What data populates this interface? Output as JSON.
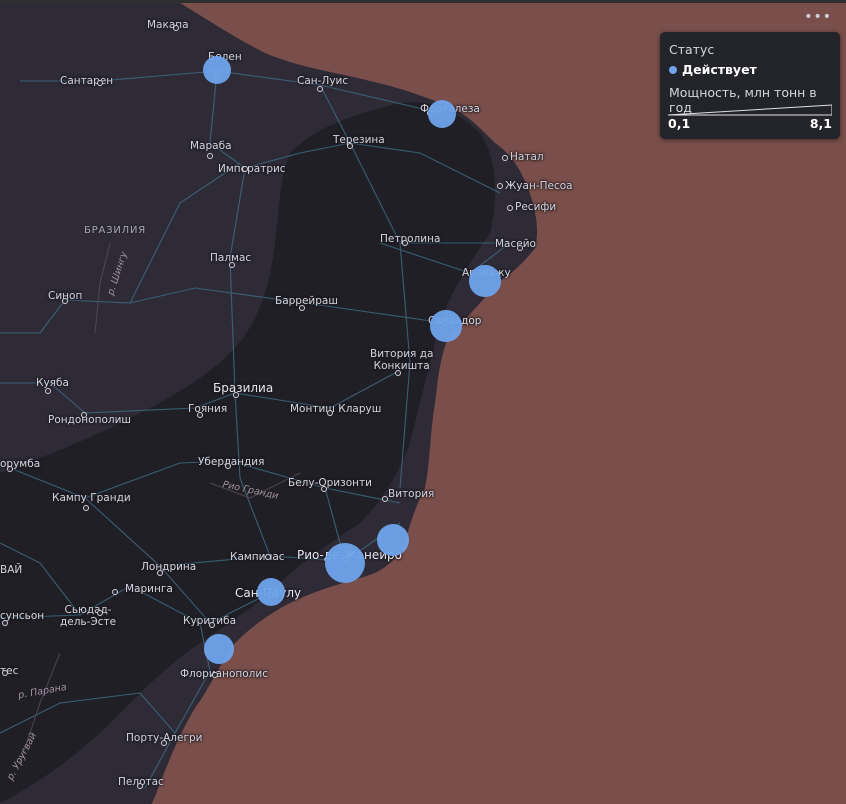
{
  "ui": {
    "menu_glyph": "•••",
    "menu_icon": "more-horizontal-icon"
  },
  "legend": {
    "title": "Статус",
    "status_label": "Действует",
    "status_color": "#6fa3ec",
    "capacity_title": "Мощность, млн тонн в год",
    "capacity_min": "0,1",
    "capacity_max": "8,1"
  },
  "colors": {
    "ocean": "#7a4e4a",
    "land": "#2e2b36",
    "land_dark": "#1d1c21",
    "roads": "#3b6a80",
    "marker": "#6fa3ec"
  },
  "map": {
    "country_label": "БРАЗИЛИЯ",
    "cities": [
      {
        "key": "makapa",
        "name": "Макапа"
      },
      {
        "key": "belen",
        "name": "Белен"
      },
      {
        "key": "santaren",
        "name": "Сантарен"
      },
      {
        "key": "sanluis",
        "name": "Сан-Луис"
      },
      {
        "key": "fortaleza",
        "name": "Форталеза"
      },
      {
        "key": "terezina",
        "name": "Терезина"
      },
      {
        "key": "maraba",
        "name": "Мараба"
      },
      {
        "key": "imperatris",
        "name": "Императрис"
      },
      {
        "key": "natal",
        "name": "Натал"
      },
      {
        "key": "zhuanpesoa",
        "name": "Жуан-Песоа"
      },
      {
        "key": "resifi",
        "name": "Ресифи"
      },
      {
        "key": "petrolina",
        "name": "Петролина"
      },
      {
        "key": "maseio",
        "name": "Масейо"
      },
      {
        "key": "palmas",
        "name": "Палмас"
      },
      {
        "key": "arakazhu",
        "name": "Аракажу"
      },
      {
        "key": "sinop",
        "name": "Синоп"
      },
      {
        "key": "barreiras",
        "name": "Баррейраш"
      },
      {
        "key": "salvador",
        "name": "Салвадор"
      },
      {
        "key": "vitoria_konk",
        "name": "Витория да\nКонкишта"
      },
      {
        "key": "kuyaba",
        "name": "Куяба"
      },
      {
        "key": "braziliya",
        "name": "Бразилиа"
      },
      {
        "key": "rondonopolis",
        "name": "Рондонополиш"
      },
      {
        "key": "goyaniya",
        "name": "Гояния"
      },
      {
        "key": "montish",
        "name": "Монтиш Кларуш"
      },
      {
        "key": "uberlandia",
        "name": "Уберландия"
      },
      {
        "key": "orumba",
        "name": "орумба"
      },
      {
        "key": "belu",
        "name": "Белу-Оризонти"
      },
      {
        "key": "vitoria",
        "name": "Витория"
      },
      {
        "key": "kampu",
        "name": "Кампу Гранди"
      },
      {
        "key": "kampinas",
        "name": "Кампинас"
      },
      {
        "key": "rio",
        "name": "Рио-де-Жанейро"
      },
      {
        "key": "londrina",
        "name": "Лондрина"
      },
      {
        "key": "maringa",
        "name": "Маринга"
      },
      {
        "key": "sanpaulu",
        "name": "Сан-Паулу"
      },
      {
        "key": "syudad",
        "name": "Сьюдад-\nдель-Эсте"
      },
      {
        "key": "sunson",
        "name": "сунсьон"
      },
      {
        "key": "kuritiba",
        "name": "Куритиба"
      },
      {
        "key": "florianopolis",
        "name": "Флорианополис"
      },
      {
        "key": "tes",
        "name": "тес"
      },
      {
        "key": "portu",
        "name": "Порту-Алегри"
      },
      {
        "key": "pelotas",
        "name": "Пелотас"
      },
      {
        "key": "vay",
        "name": "ВАЙ"
      }
    ],
    "rivers": [
      {
        "key": "shingu",
        "name": "р. Шингу"
      },
      {
        "key": "grandi",
        "name": "Рио Гранди"
      },
      {
        "key": "parana",
        "name": "р. Парана"
      },
      {
        "key": "urugvai",
        "name": "р. Уругвай"
      }
    ],
    "terminals": [
      {
        "key": "t-belen",
        "capacity": 1.6
      },
      {
        "key": "t-fortaleza",
        "capacity": 1.6
      },
      {
        "key": "t-arakazhu",
        "capacity": 2.6
      },
      {
        "key": "t-salvador",
        "capacity": 2.6
      },
      {
        "key": "t-vitoria",
        "capacity": 3.0
      },
      {
        "key": "t-rio",
        "capacity": 8.1
      },
      {
        "key": "t-sanpaulu",
        "capacity": 1.6
      },
      {
        "key": "t-kuritiba",
        "capacity": 1.9
      }
    ]
  }
}
